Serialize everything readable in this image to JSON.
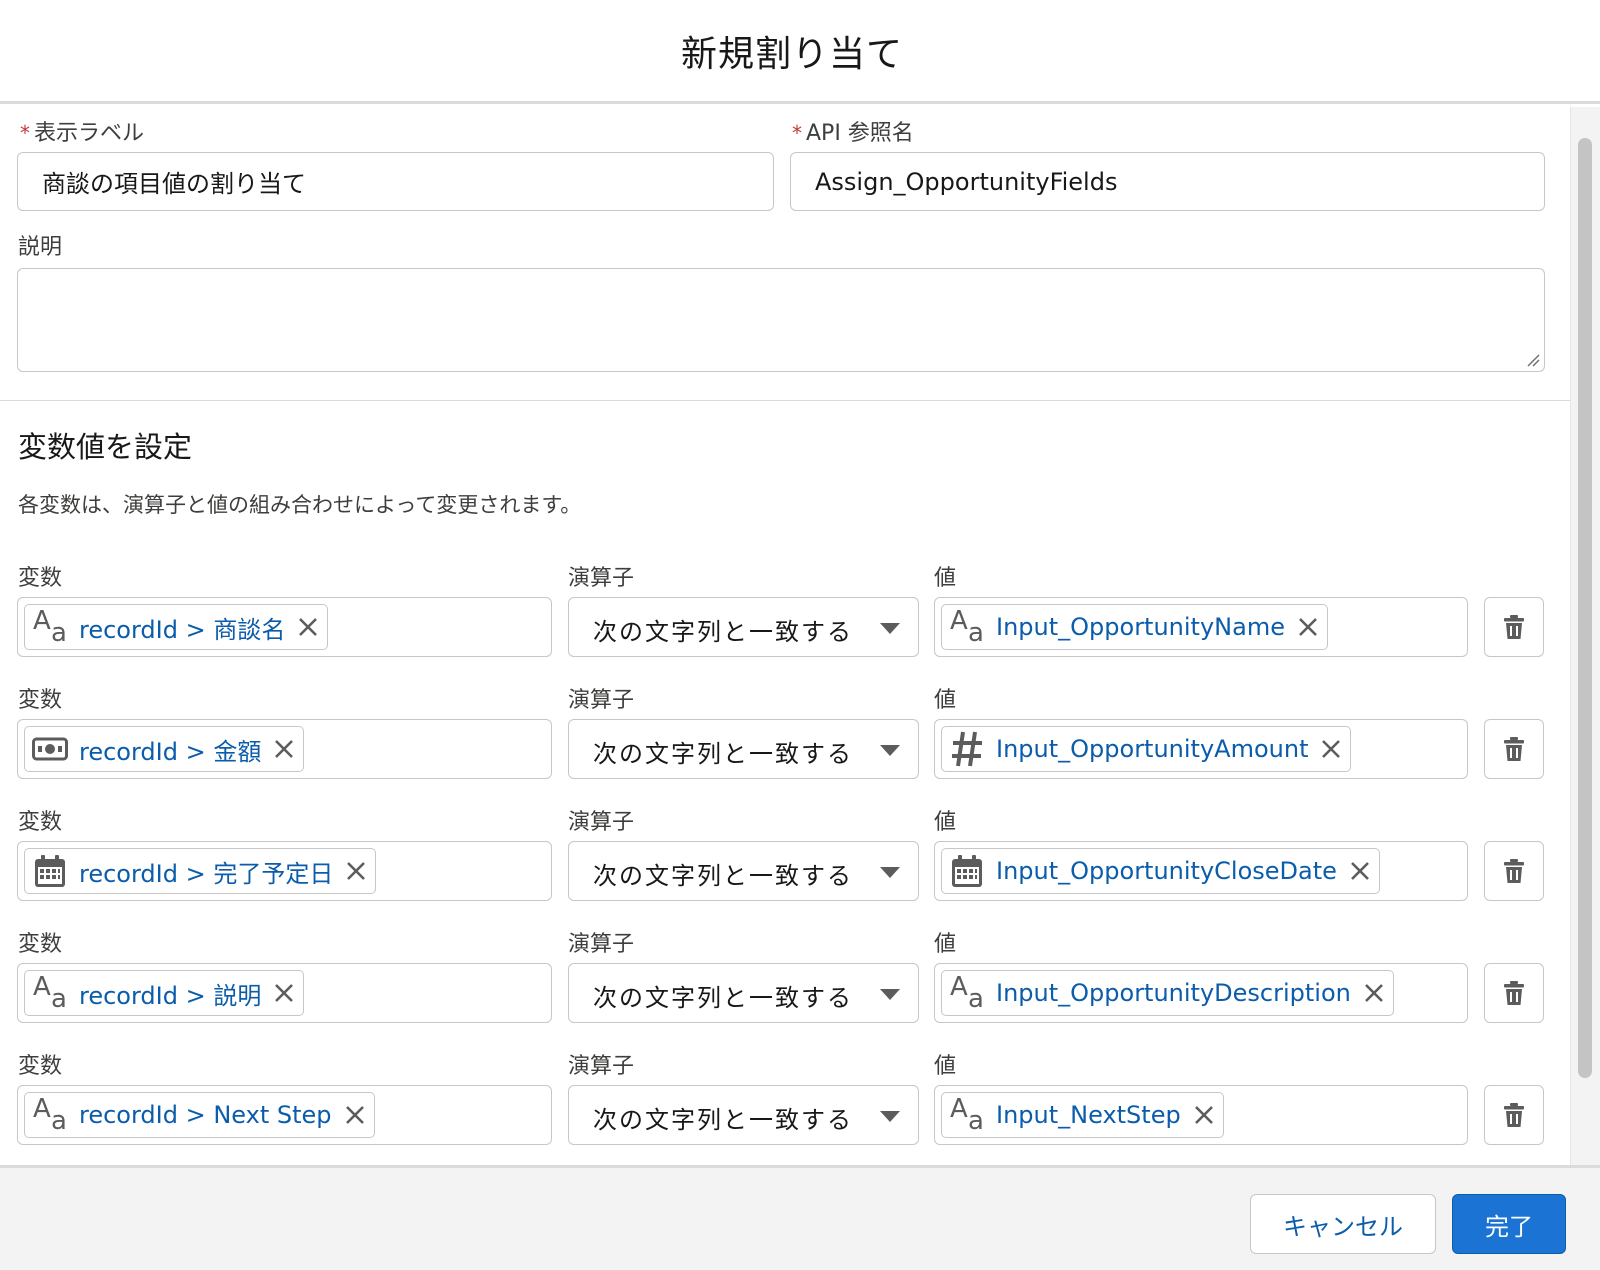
{
  "dialog": {
    "title": "新規割り当て",
    "cancel_label": "キャンセル",
    "done_label": "完了"
  },
  "form": {
    "required_mark": "*",
    "display_label": {
      "label": "表示ラベル",
      "value": "商談の項目値の割り当て"
    },
    "api_name": {
      "label": "API 参照名",
      "value": "Assign_OpportunityFields"
    },
    "description": {
      "label": "説明",
      "value": ""
    }
  },
  "section": {
    "title": "変数値を設定",
    "description": "各変数は、演算子と値の組み合わせによって変更されます。"
  },
  "assignment_labels": {
    "variable": "変数",
    "operator": "演算子",
    "value": "値"
  },
  "assignments": [
    {
      "variable": {
        "icon": "text-icon",
        "text": "recordId > 商談名"
      },
      "operator": "次の文字列と一致する",
      "value": {
        "icon": "text-icon",
        "text": "Input_OpportunityName"
      }
    },
    {
      "variable": {
        "icon": "currency-icon",
        "text": "recordId > 金額"
      },
      "operator": "次の文字列と一致する",
      "value": {
        "icon": "number-icon",
        "text": "Input_OpportunityAmount"
      }
    },
    {
      "variable": {
        "icon": "calendar-icon",
        "text": "recordId > 完了予定日"
      },
      "operator": "次の文字列と一致する",
      "value": {
        "icon": "calendar-icon",
        "text": "Input_OpportunityCloseDate"
      }
    },
    {
      "variable": {
        "icon": "text-icon",
        "text": "recordId > 説明"
      },
      "operator": "次の文字列と一致する",
      "value": {
        "icon": "text-icon",
        "text": "Input_OpportunityDescription"
      }
    },
    {
      "variable": {
        "icon": "text-icon",
        "text": "recordId > Next Step"
      },
      "operator": "次の文字列と一致する",
      "value": {
        "icon": "text-icon",
        "text": "Input_NextStep"
      }
    }
  ],
  "colors": {
    "brand": "#1b73d3",
    "link": "#0b5cab",
    "required": "#c23934",
    "border": "#c9c7c5"
  }
}
